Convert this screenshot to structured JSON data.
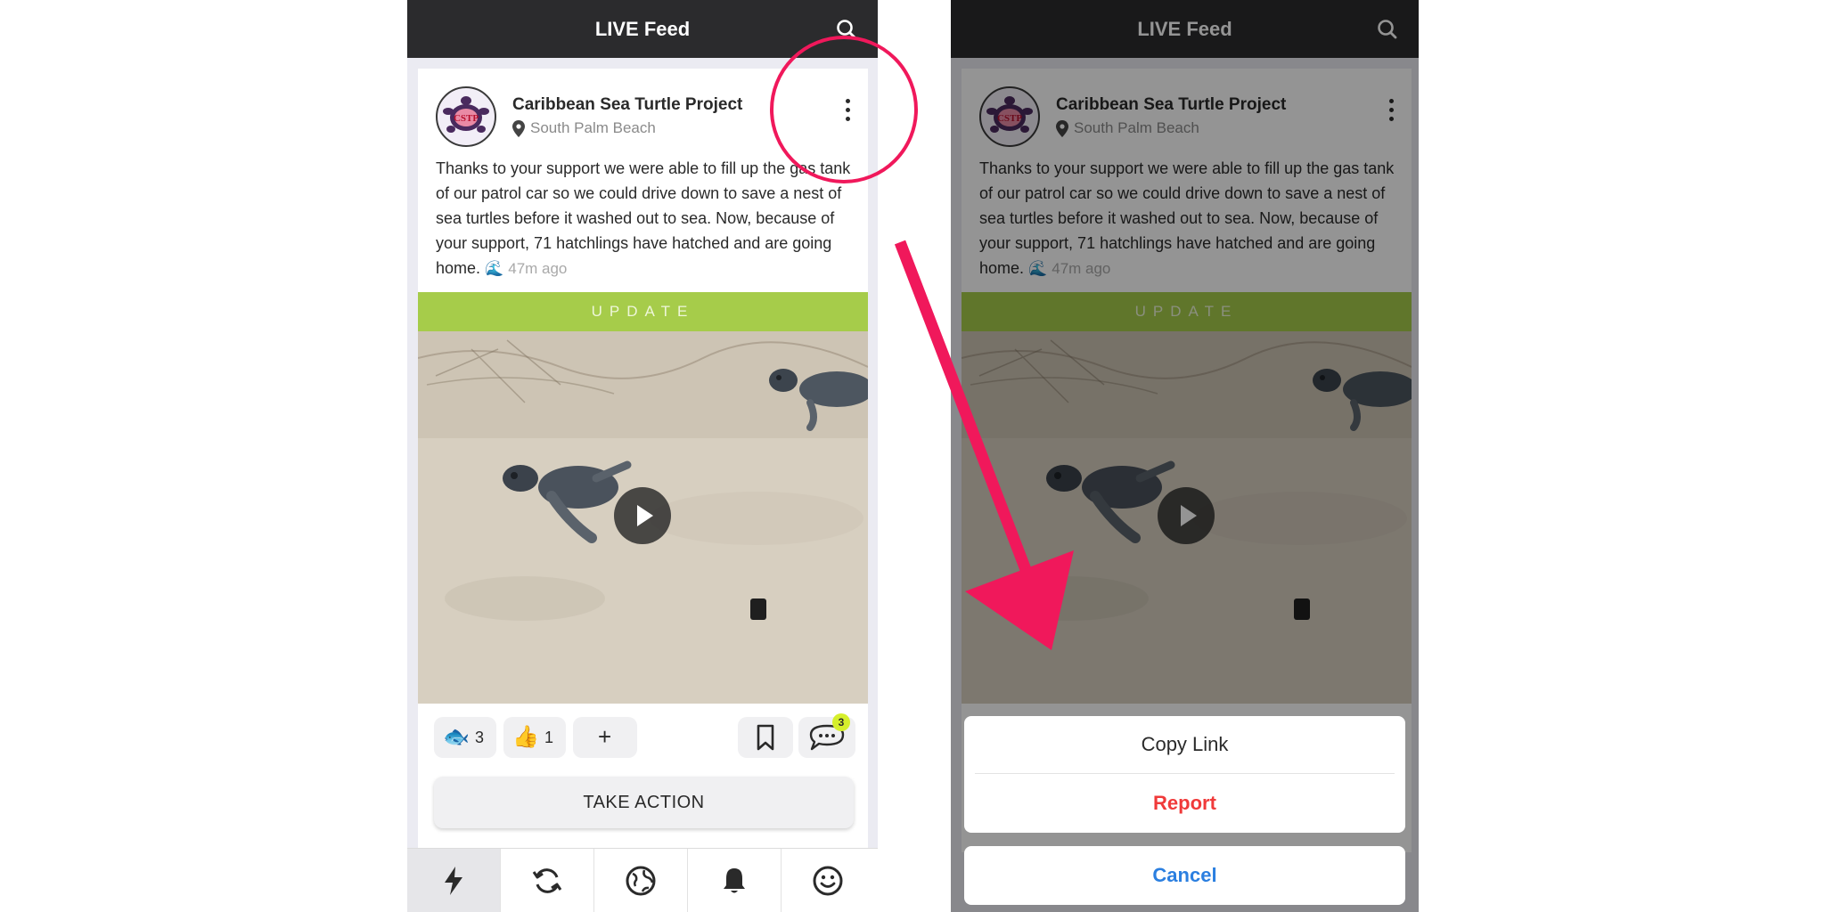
{
  "header": {
    "title": "LIVE Feed"
  },
  "post": {
    "org_name": "Caribbean Sea Turtle Project",
    "avatar_text": "CSTP",
    "location": "South Palm Beach",
    "body": "Thanks to your support we were able to fill up the gas tank of our patrol car so we could drive down to save a nest of sea turtles before it washed out to sea. Now, because of your support, 71 hatchlings have hatched and are going home.",
    "wave_emoji": "🌊",
    "time_ago": "47m ago",
    "banner": "UPDATE"
  },
  "reactions": [
    {
      "emoji": "🐟",
      "count": "3"
    },
    {
      "emoji": "👍",
      "count": "1"
    }
  ],
  "add_reaction": "+",
  "comment_count": "3",
  "take_action": "TAKE ACTION",
  "action_sheet": {
    "copy_link": "Copy Link",
    "report": "Report",
    "cancel": "Cancel"
  },
  "colors": {
    "nav_bg": "#2b2b2d",
    "banner": "#a6cc4a",
    "annotation": "#f0185b",
    "report": "#f03a3a",
    "cancel": "#2b7fe0",
    "badge": "#d6ef2c"
  },
  "tabs": [
    "bolt-icon",
    "refresh-icon",
    "globe-icon",
    "bell-icon",
    "smiley-icon"
  ]
}
